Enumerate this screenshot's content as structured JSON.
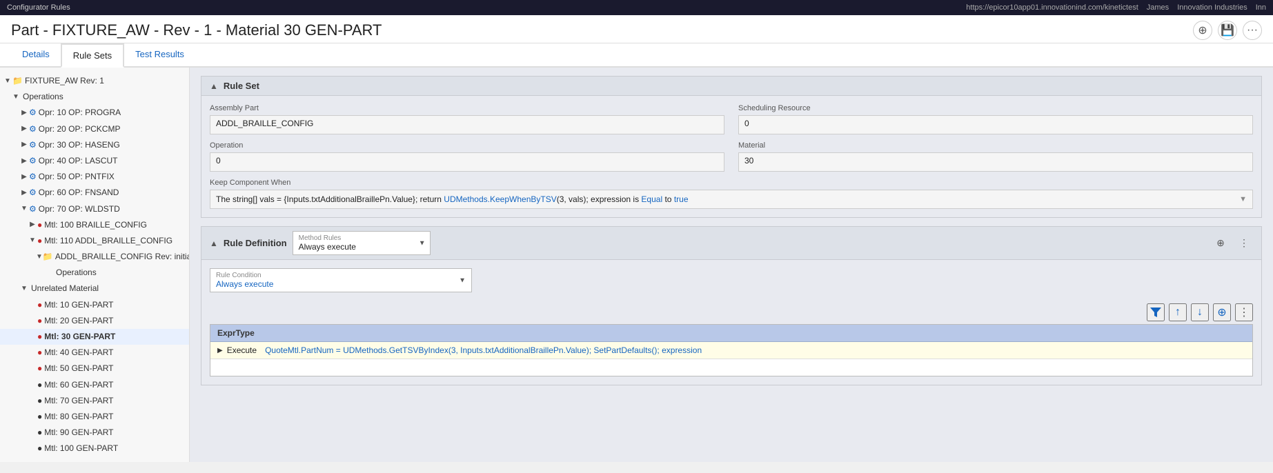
{
  "topbar": {
    "left_label": "Configurator Rules",
    "right_url": "https://epicor10app01.innovationind.com/kinetictest",
    "right_user": "James",
    "right_company": "Innovation Industries",
    "right_extra": "Inn"
  },
  "page_title": "Part - FIXTURE_AW - Rev - 1 - Material 30 GEN-PART",
  "header_actions": {
    "add_label": "+",
    "save_label": "💾",
    "more_label": "···"
  },
  "tabs": [
    {
      "id": "details",
      "label": "Details"
    },
    {
      "id": "rule-sets",
      "label": "Rule Sets",
      "active": true
    },
    {
      "id": "test-results",
      "label": "Test Results"
    }
  ],
  "sidebar": {
    "items": [
      {
        "id": "fixture-rev",
        "indent": 0,
        "chevron": "▼",
        "icon": "folder",
        "label": "FIXTURE_AW Rev: 1"
      },
      {
        "id": "operations-group",
        "indent": 1,
        "chevron": "▼",
        "icon": null,
        "label": "Operations"
      },
      {
        "id": "opr-10",
        "indent": 2,
        "chevron": "▶",
        "icon": "op",
        "label": "Opr: 10 OP: PROGRA"
      },
      {
        "id": "opr-20",
        "indent": 2,
        "chevron": "▶",
        "icon": "op",
        "label": "Opr: 20 OP: PCKCMP"
      },
      {
        "id": "opr-30",
        "indent": 2,
        "chevron": "▶",
        "icon": "op",
        "label": "Opr: 30 OP: HASENG"
      },
      {
        "id": "opr-40",
        "indent": 2,
        "chevron": "▶",
        "icon": "op",
        "label": "Opr: 40 OP: LASCUT"
      },
      {
        "id": "opr-50",
        "indent": 2,
        "chevron": "▶",
        "icon": "op",
        "label": "Opr: 50 OP: PNTFIX"
      },
      {
        "id": "opr-60",
        "indent": 2,
        "chevron": "▶",
        "icon": "op",
        "label": "Opr: 60 OP: FNSAND"
      },
      {
        "id": "opr-70",
        "indent": 2,
        "chevron": "▼",
        "icon": "op",
        "label": "Opr: 70 OP: WLDSTD"
      },
      {
        "id": "mtl-100",
        "indent": 3,
        "chevron": "▶",
        "icon": "mtl",
        "label": "Mtl: 100 BRAILLE_CONFIG"
      },
      {
        "id": "mtl-110",
        "indent": 3,
        "chevron": "▼",
        "icon": "mtl",
        "label": "Mtl: 110 ADDL_BRAILLE_CONFIG"
      },
      {
        "id": "addl-config",
        "indent": 4,
        "chevron": "▼",
        "icon": "folder",
        "label": "ADDL_BRAILLE_CONFIG Rev: initial"
      },
      {
        "id": "operations-sub",
        "indent": 5,
        "chevron": null,
        "icon": null,
        "label": "Operations"
      },
      {
        "id": "unrelated-mat",
        "indent": 2,
        "chevron": "▼",
        "icon": null,
        "label": "Unrelated Material"
      },
      {
        "id": "mtl-10",
        "indent": 3,
        "chevron": null,
        "icon": "mtl-red",
        "label": "Mtl: 10 GEN-PART",
        "selected": false
      },
      {
        "id": "mtl-20",
        "indent": 3,
        "chevron": null,
        "icon": "mtl-red",
        "label": "Mtl: 20 GEN-PART"
      },
      {
        "id": "mtl-30",
        "indent": 3,
        "chevron": null,
        "icon": "mtl-red",
        "label": "Mtl: 30 GEN-PART",
        "selected": true
      },
      {
        "id": "mtl-40",
        "indent": 3,
        "chevron": null,
        "icon": "mtl-red",
        "label": "Mtl: 40 GEN-PART"
      },
      {
        "id": "mtl-50",
        "indent": 3,
        "chevron": null,
        "icon": "mtl-red",
        "label": "Mtl: 50 GEN-PART"
      },
      {
        "id": "mtl-60",
        "indent": 3,
        "chevron": null,
        "icon": "mtl-dark",
        "label": "Mtl: 60 GEN-PART"
      },
      {
        "id": "mtl-70",
        "indent": 3,
        "chevron": null,
        "icon": "mtl-dark",
        "label": "Mtl: 70 GEN-PART"
      },
      {
        "id": "mtl-80",
        "indent": 3,
        "chevron": null,
        "icon": "mtl-dark",
        "label": "Mtl: 80 GEN-PART"
      },
      {
        "id": "mtl-90",
        "indent": 3,
        "chevron": null,
        "icon": "mtl-dark",
        "label": "Mtl: 90 GEN-PART"
      },
      {
        "id": "mtl-100b",
        "indent": 3,
        "chevron": null,
        "icon": "mtl-dark",
        "label": "Mtl: 100 GEN-PART"
      }
    ]
  },
  "rule_set": {
    "title": "Rule Set",
    "assembly_part_label": "Assembly Part",
    "assembly_part_value": "ADDL_BRAILLE_CONFIG",
    "scheduling_resource_label": "Scheduling Resource",
    "scheduling_resource_value": "0",
    "operation_label": "Operation",
    "operation_value": "0",
    "material_label": "Material",
    "material_value": "30",
    "keep_component_label": "Keep Component When",
    "keep_component_value": "The string[] vals = {Inputs.txtAdditionalBraillePn.Value}; return UDMethods.KeepWhenByTSV(3, vals); expression is Equal to true"
  },
  "rule_definition": {
    "title": "Rule Definition",
    "method_rules_label": "Method Rules",
    "method_rules_value": "Always execute",
    "rule_condition_label": "Rule Condition",
    "rule_condition_value": "Always execute"
  },
  "expr_table": {
    "header": "ExprType",
    "row_prefix": "Execute",
    "row_value": "QuoteMtl.PartNum = UDMethods.GetTSVByIndex(3, Inputs.txtAdditionalBraillePn.Value); SetPartDefaults(); expression"
  }
}
